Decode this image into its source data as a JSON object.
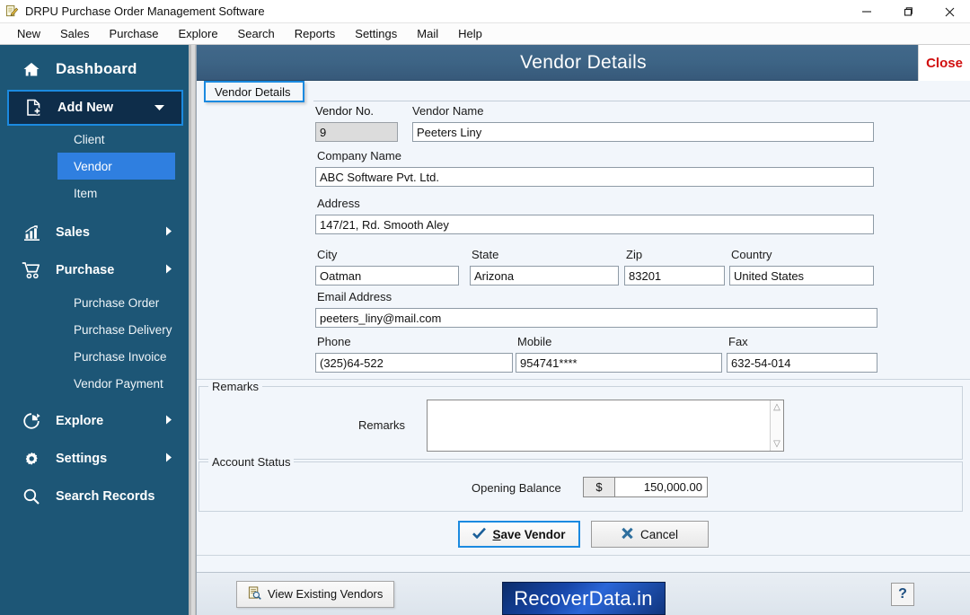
{
  "window": {
    "title": "DRPU Purchase Order Management Software",
    "icon": "app-document-pencil-icon",
    "controls": {
      "minimize": "minimize-icon",
      "restore": "restore-icon",
      "close": "close-icon"
    }
  },
  "menubar": {
    "items": [
      "New",
      "Sales",
      "Purchase",
      "Explore",
      "Search",
      "Reports",
      "Settings",
      "Mail",
      "Help"
    ]
  },
  "sidebar": {
    "bg_color": "#1d5676",
    "accent_color": "#2f7fe0",
    "dashboard": {
      "label": "Dashboard",
      "icon": "home-icon"
    },
    "add_new": {
      "label": "Add New",
      "icon": "add-document-icon",
      "arrow": "chevron-down-icon",
      "selected": true
    },
    "add_new_children": [
      {
        "label": "Client",
        "active": false
      },
      {
        "label": "Vendor",
        "active": true
      },
      {
        "label": "Item",
        "active": false
      }
    ],
    "sales": {
      "label": "Sales",
      "icon": "bar-chart-icon",
      "arrow": "chevron-right-icon"
    },
    "purchase": {
      "label": "Purchase",
      "icon": "shopping-cart-icon",
      "arrow": "chevron-right-icon"
    },
    "purchase_children": [
      {
        "label": "Purchase Order"
      },
      {
        "label": "Purchase Delivery"
      },
      {
        "label": "Purchase Invoice"
      },
      {
        "label": "Vendor Payment"
      }
    ],
    "explore": {
      "label": "Explore",
      "icon": "pie-chart-icon",
      "arrow": "chevron-right-icon"
    },
    "settings": {
      "label": "Settings",
      "icon": "gear-icon",
      "arrow": "chevron-right-icon"
    },
    "search_records": {
      "label": "Search Records",
      "icon": "search-icon"
    }
  },
  "form": {
    "header_title": "Vendor Details",
    "close_label": "Close",
    "close_color": "#d10f0f",
    "tab_label": "Vendor Details",
    "fields": {
      "vendor_no": {
        "label": "Vendor No.",
        "value": "9",
        "readonly": true
      },
      "vendor_name": {
        "label": "Vendor Name",
        "value": "Peeters Liny"
      },
      "company_name": {
        "label": "Company Name",
        "value": "ABC Software Pvt. Ltd."
      },
      "address": {
        "label": "Address",
        "value": "147/21, Rd. Smooth Aley"
      },
      "city": {
        "label": "City",
        "value": "Oatman"
      },
      "state": {
        "label": "State",
        "value": "Arizona"
      },
      "zip": {
        "label": "Zip",
        "value": "83201"
      },
      "country": {
        "label": "Country",
        "value": "United States"
      },
      "email": {
        "label": "Email Address",
        "value": "peeters_liny@mail.com"
      },
      "phone": {
        "label": "Phone",
        "value": "(325)64-522"
      },
      "mobile": {
        "label": "Mobile",
        "value": "954741****"
      },
      "fax": {
        "label": "Fax",
        "value": "632-54-014"
      }
    },
    "remarks_group": {
      "legend": "Remarks",
      "field_label": "Remarks",
      "value": ""
    },
    "account_status_group": {
      "legend": "Account Status",
      "opening_balance_label": "Opening Balance",
      "currency_symbol": "$",
      "opening_balance_value": "150,000.00"
    },
    "buttons": {
      "save": {
        "label": "Save Vendor",
        "accel": "S",
        "icon": "check-icon",
        "primary": true
      },
      "cancel": {
        "label": "Cancel",
        "icon": "x-mark-icon"
      }
    }
  },
  "statusbar": {
    "view_existing": {
      "label": "View Existing Vendors",
      "icon": "list-search-icon"
    },
    "brand": "RecoverData.in",
    "help": "?"
  }
}
